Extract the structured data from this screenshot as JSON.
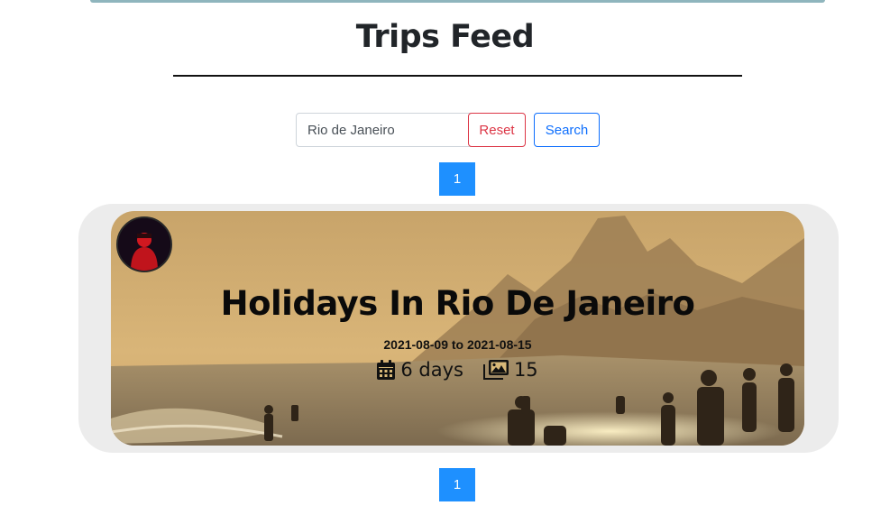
{
  "header": {
    "title": "Trips Feed"
  },
  "search": {
    "value": "Rio de Janeiro",
    "reset_label": "Reset",
    "search_label": "Search"
  },
  "pagination": {
    "top_page": "1",
    "bottom_page": "1"
  },
  "trip": {
    "title": "Holidays In Rio De Janeiro",
    "dates": "2021-08-09 to 2021-08-15",
    "duration": "6 days",
    "photo_count": "15",
    "icons": [
      "calendar-icon",
      "images-icon"
    ]
  },
  "colors": {
    "pager_bg": "#1e90ff",
    "reset": "#dc3545",
    "search": "#0d6efd",
    "accent_strip": "#8fb5bd"
  }
}
